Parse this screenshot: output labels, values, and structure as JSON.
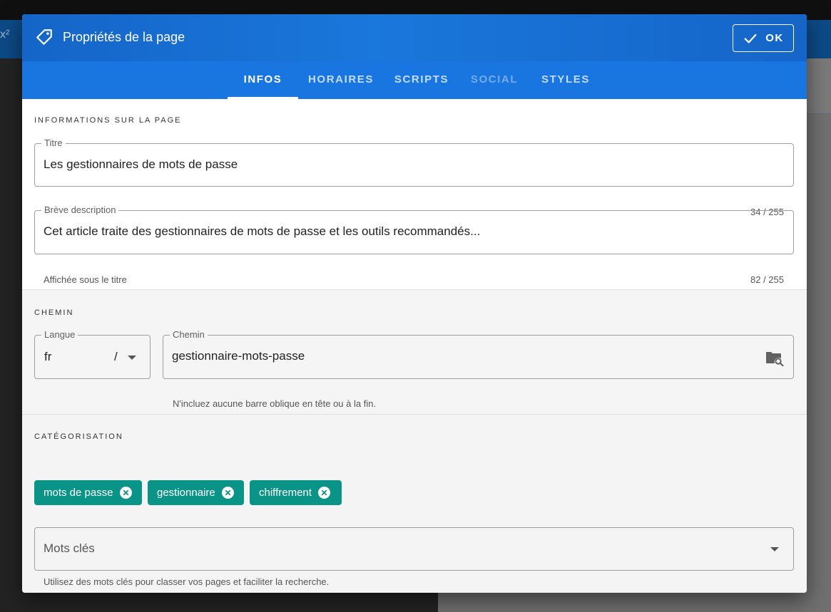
{
  "background": {
    "glyph": "x²"
  },
  "dialog": {
    "title": "Propriétés de la page",
    "title_icon": "tag-icon",
    "ok_label": "OK",
    "ok_icon": "check-icon",
    "accent_color": "#1976e0",
    "chip_color": "#0a9488"
  },
  "tabs": [
    {
      "label": "INFOS",
      "state": "active"
    },
    {
      "label": "HORAIRES",
      "state": "normal"
    },
    {
      "label": "SCRIPTS",
      "state": "normal"
    },
    {
      "label": "SOCIAL",
      "state": "disabled"
    },
    {
      "label": "STYLES",
      "state": "normal"
    }
  ],
  "info": {
    "section_label": "INFORMATIONS SUR LA PAGE",
    "title_field": {
      "label": "Titre",
      "value": "Les gestionnaires de mots de passe",
      "counter": "34 / 255"
    },
    "description_field": {
      "label": "Brève description",
      "value": "Cet article traite des gestionnaires de mots de passe et les outils recommandés...",
      "hint": "Affichée sous le titre",
      "counter": "82 / 255"
    }
  },
  "path": {
    "section_label": "CHEMIN",
    "locale_field": {
      "label": "Langue",
      "value": "fr",
      "separator": "/"
    },
    "path_field": {
      "label": "Chemin",
      "value": "gestionnaire-mots-passe",
      "icon": "folder-search-icon",
      "hint": "N'incluez aucune barre oblique en tête ou à la fin."
    }
  },
  "categorization": {
    "section_label": "CATÉGORISATION",
    "tags": [
      "mots de passe",
      "gestionnaire",
      "chiffrement"
    ],
    "keywords_field": {
      "placeholder": "Mots clés",
      "hint": "Utilisez des mots clés pour classer vos pages et faciliter la recherche."
    }
  }
}
